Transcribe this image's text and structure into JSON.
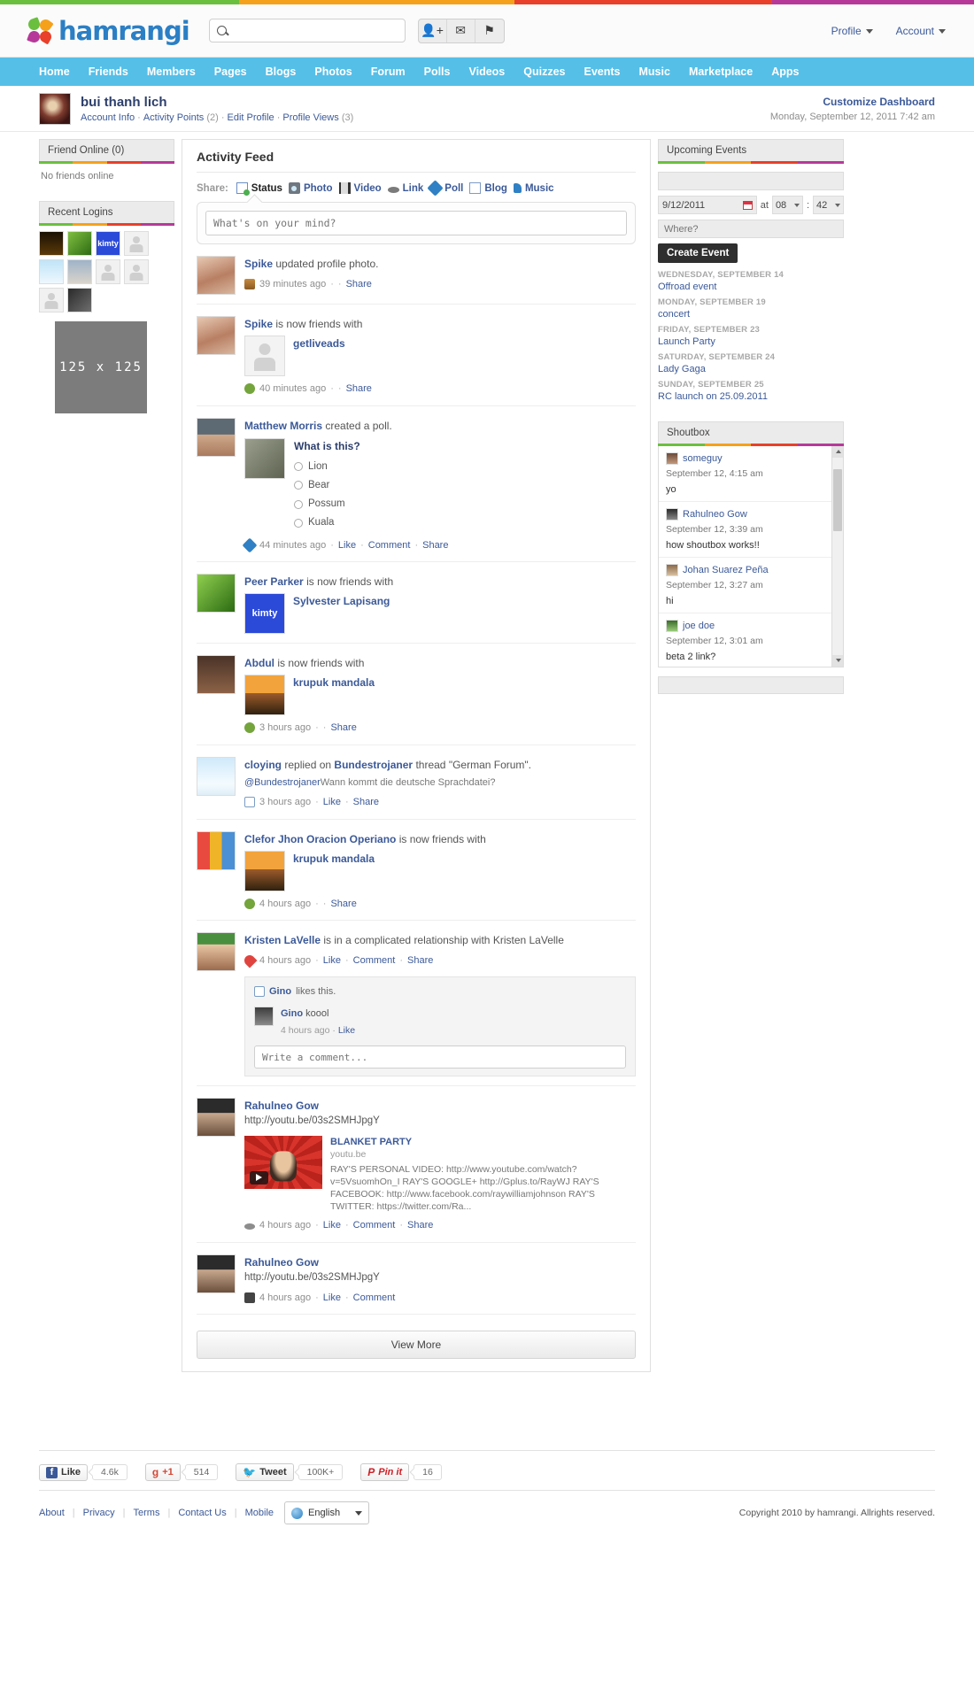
{
  "brand": {
    "name": "hamrangi",
    "stripe_colors": [
      "#6bbf3f",
      "#f5a11b",
      "#e8402a",
      "#b6399a"
    ]
  },
  "header": {
    "search_placeholder": "",
    "icons": [
      "add-friend-icon",
      "message-icon",
      "flag-icon"
    ],
    "menus": [
      {
        "label": "Profile"
      },
      {
        "label": "Account"
      }
    ]
  },
  "nav": {
    "items": [
      "Home",
      "Friends",
      "Members",
      "Pages",
      "Blogs",
      "Photos",
      "Forum",
      "Polls",
      "Videos",
      "Quizzes",
      "Events",
      "Music",
      "Marketplace",
      "Apps"
    ]
  },
  "profile_bar": {
    "name": "bui thanh lich",
    "links": [
      {
        "label": "Account Info",
        "count": ""
      },
      {
        "label": "Activity Points",
        "count": "(2)"
      },
      {
        "label": "Edit Profile",
        "count": ""
      },
      {
        "label": "Profile Views",
        "count": "(3)"
      }
    ],
    "customize": "Customize Dashboard",
    "datetime": "Monday, September 12, 2011 7:42 am"
  },
  "sidebar": {
    "friends_online": {
      "title": "Friend Online (0)",
      "empty_text": "No friends online"
    },
    "recent_logins": {
      "title": "Recent Logins",
      "thumbs": [
        {
          "kind": "candle",
          "label": ""
        },
        {
          "kind": "leaf",
          "label": ""
        },
        {
          "kind": "kimty",
          "label": "kimty"
        },
        {
          "kind": "placeholder",
          "label": ""
        },
        {
          "kind": "sky",
          "label": ""
        },
        {
          "kind": "man",
          "label": ""
        },
        {
          "kind": "placeholder",
          "label": ""
        },
        {
          "kind": "placeholder",
          "label": ""
        },
        {
          "kind": "placeholder",
          "label": ""
        },
        {
          "kind": "dark",
          "label": ""
        }
      ]
    },
    "ad": {
      "label": "125 x 125"
    }
  },
  "feed": {
    "title": "Activity Feed",
    "share_label": "Share:",
    "share_items": [
      {
        "label": "Status",
        "icon": "status-icon",
        "active": true
      },
      {
        "label": "Photo",
        "icon": "photo-icon",
        "active": false
      },
      {
        "label": "Video",
        "icon": "video-icon",
        "active": false
      },
      {
        "label": "Link",
        "icon": "link-icon",
        "active": false
      },
      {
        "label": "Poll",
        "icon": "poll-icon",
        "active": false
      },
      {
        "label": "Blog",
        "icon": "blog-icon",
        "active": false
      },
      {
        "label": "Music",
        "icon": "music-icon",
        "active": false
      }
    ],
    "status_placeholder": "What's on your mind?",
    "view_more": "View More",
    "items": [
      {
        "who": "Spike",
        "action": "updated profile photo.",
        "time": "39 minutes ago",
        "actions": [
          "Share"
        ]
      },
      {
        "who": "Spike",
        "action": "is now friends with",
        "friend": "getliveads",
        "time": "40 minutes ago",
        "actions": [
          "Share"
        ]
      },
      {
        "who": "Matthew Morris",
        "action": "created a poll.",
        "poll_question": "What is this?",
        "poll_options": [
          "Lion",
          "Bear",
          "Possum",
          "Kuala"
        ],
        "time": "44 minutes ago",
        "actions": [
          "Like",
          "Comment",
          "Share"
        ]
      },
      {
        "who": "Peer Parker",
        "action": "is now friends with",
        "friend": "Sylvester Lapisang",
        "time": "",
        "actions": []
      },
      {
        "who": "Abdul",
        "action": "is now friends with",
        "friend": "krupuk mandala",
        "time": "3 hours ago",
        "actions": [
          "Share"
        ]
      },
      {
        "who": "cloying",
        "action": "replied on",
        "thread_owner": "Bundestrojaner",
        "action2": "thread \"German Forum\".",
        "quote_at": "@Bundestrojaner",
        "quote_text": "Wann kommt die deutsche Sprachdatei?",
        "time": "3 hours ago",
        "actions": [
          "Like",
          "Share"
        ]
      },
      {
        "who": "Clefor Jhon Oracion Operiano",
        "action": "is now friends with",
        "friend": "krupuk mandala",
        "time": "4 hours ago",
        "actions": [
          "Share"
        ]
      },
      {
        "who": "Kristen LaVelle",
        "action": "is in a complicated relationship with Kristen LaVelle",
        "time": "4 hours ago",
        "actions": [
          "Like",
          "Comment",
          "Share"
        ],
        "likes_text_user": "Gino",
        "likes_text_rest": "likes this.",
        "comment_user": "Gino",
        "comment_text": "koool",
        "comment_time": "4 hours ago",
        "comment_action": "Like",
        "comment_placeholder": "Write a comment..."
      },
      {
        "who": "Rahulneo Gow",
        "action": "",
        "url": "http://youtu.be/03s2SMHJpgY",
        "card_title": "BLANKET PARTY",
        "card_host": "youtu.be",
        "card_desc": "RAY'S PERSONAL VIDEO: http://www.youtube.com/watch?v=5VsuomhOn_I RAY'S GOOGLE+ http://Gplus.to/RayWJ RAY'S FACEBOOK: http://www.facebook.com/raywilliamjohnson RAY'S TWITTER: https://twitter.com/Ra...",
        "time": "4 hours ago",
        "actions": [
          "Like",
          "Comment",
          "Share"
        ]
      },
      {
        "who": "Rahulneo Gow",
        "action": "",
        "url": "http://youtu.be/03s2SMHJpgY",
        "time": "4 hours ago",
        "actions": [
          "Like",
          "Comment"
        ]
      }
    ]
  },
  "events": {
    "title": "Upcoming Events",
    "what_placeholder": "",
    "date_value": "9/12/2011",
    "at_label": "at",
    "hour_value": "08",
    "minute_sep": ":",
    "minute_value": "42",
    "where_placeholder": "Where?",
    "create_button": "Create Event",
    "list": [
      {
        "day": "Wednesday, September 14",
        "name": "Offroad event"
      },
      {
        "day": "Monday, September 19",
        "name": "concert"
      },
      {
        "day": "Friday, September 23",
        "name": "Launch Party"
      },
      {
        "day": "Saturday, September 24",
        "name": "Lady Gaga"
      },
      {
        "day": "Sunday, September 25",
        "name": "RC launch on 25.09.2011"
      }
    ]
  },
  "shoutbox": {
    "title": "Shoutbox",
    "messages": [
      {
        "user": "someguy",
        "time": "September 12, 4:15 am",
        "text": "yo"
      },
      {
        "user": "Rahulneo Gow",
        "time": "September 12, 3:39 am",
        "text": "how shoutbox works!!"
      },
      {
        "user": "Johan Suarez Peña",
        "time": "September 12, 3:27 am",
        "text": "hi"
      },
      {
        "user": "joe doe",
        "time": "September 12, 3:01 am",
        "text": "beta 2 link?"
      }
    ]
  },
  "social_buttons": [
    {
      "network": "facebook",
      "label": "Like",
      "count": "4.6k"
    },
    {
      "network": "google-plus",
      "label": "+1",
      "count": "514"
    },
    {
      "network": "twitter",
      "label": "Tweet",
      "count": "100K+"
    },
    {
      "network": "pinterest",
      "label": "Pin it",
      "count": "16"
    }
  ],
  "footer": {
    "links": [
      "About",
      "Privacy",
      "Terms",
      "Contact Us",
      "Mobile"
    ],
    "language": "English",
    "copyright": "Copyright 2010 by hamrangi. Allrights reserved."
  }
}
